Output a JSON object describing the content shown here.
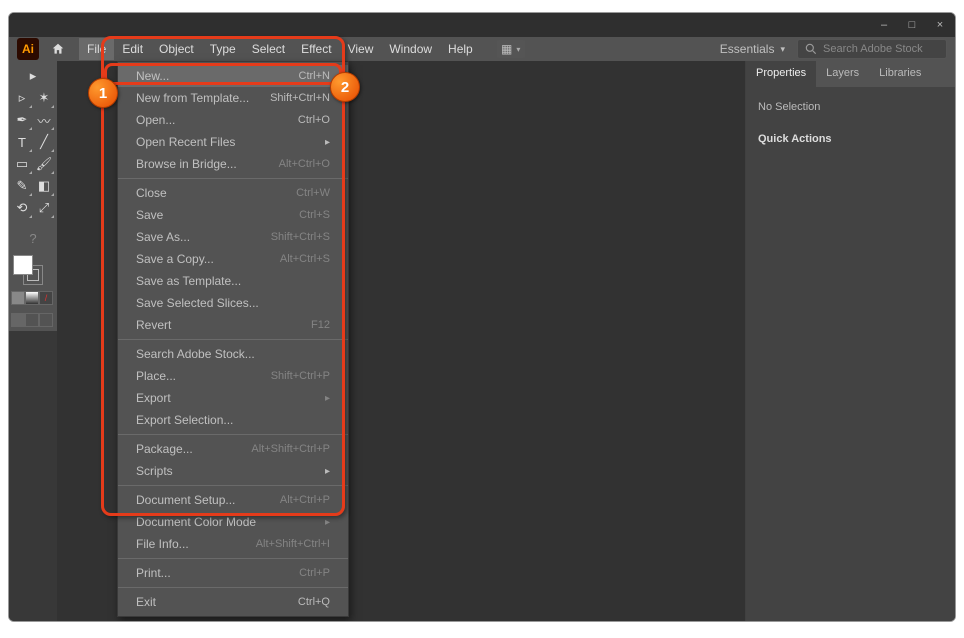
{
  "window_controls": {
    "min": "–",
    "max": "□",
    "close": "×"
  },
  "menubar": {
    "items": [
      "File",
      "Edit",
      "Object",
      "Type",
      "Select",
      "Effect",
      "View",
      "Window",
      "Help"
    ],
    "active_index": 0,
    "essentials_label": "Essentials"
  },
  "search": {
    "placeholder": "Search Adobe Stock"
  },
  "dropdown": {
    "highlight_index": 0,
    "groups": [
      [
        {
          "label": "New...",
          "shortcut": "Ctrl+N"
        },
        {
          "label": "New from Template...",
          "shortcut": "Shift+Ctrl+N"
        },
        {
          "label": "Open...",
          "shortcut": "Ctrl+O"
        },
        {
          "label": "Open Recent Files",
          "shortcut": "",
          "submenu": true
        },
        {
          "label": "Browse in Bridge...",
          "shortcut": "Alt+Ctrl+O",
          "disabled": true
        }
      ],
      [
        {
          "label": "Close",
          "shortcut": "Ctrl+W",
          "disabled": true
        },
        {
          "label": "Save",
          "shortcut": "Ctrl+S",
          "disabled": true
        },
        {
          "label": "Save As...",
          "shortcut": "Shift+Ctrl+S",
          "disabled": true
        },
        {
          "label": "Save a Copy...",
          "shortcut": "Alt+Ctrl+S",
          "disabled": true
        },
        {
          "label": "Save as Template...",
          "shortcut": "",
          "disabled": true
        },
        {
          "label": "Save Selected Slices...",
          "shortcut": "",
          "disabled": true
        },
        {
          "label": "Revert",
          "shortcut": "F12",
          "disabled": true
        }
      ],
      [
        {
          "label": "Search Adobe Stock...",
          "shortcut": ""
        },
        {
          "label": "Place...",
          "shortcut": "Shift+Ctrl+P",
          "disabled": true
        },
        {
          "label": "Export",
          "shortcut": "",
          "submenu": true,
          "disabled": true
        },
        {
          "label": "Export Selection...",
          "shortcut": "",
          "disabled": true
        }
      ],
      [
        {
          "label": "Package...",
          "shortcut": "Alt+Shift+Ctrl+P",
          "disabled": true
        },
        {
          "label": "Scripts",
          "shortcut": "",
          "submenu": true
        }
      ],
      [
        {
          "label": "Document Setup...",
          "shortcut": "Alt+Ctrl+P",
          "disabled": true
        },
        {
          "label": "Document Color Mode",
          "shortcut": "",
          "submenu": true,
          "disabled": true
        },
        {
          "label": "File Info...",
          "shortcut": "Alt+Shift+Ctrl+I",
          "disabled": true
        }
      ],
      [
        {
          "label": "Print...",
          "shortcut": "Ctrl+P",
          "disabled": true
        }
      ],
      [
        {
          "label": "Exit",
          "shortcut": "Ctrl+Q"
        }
      ]
    ]
  },
  "right_panel": {
    "tabs": [
      "Properties",
      "Layers",
      "Libraries"
    ],
    "active_tab": 0,
    "no_selection": "No Selection",
    "quick_actions": "Quick Actions"
  },
  "callouts": {
    "badge1": "1",
    "badge2": "2"
  },
  "logo": "Ai"
}
